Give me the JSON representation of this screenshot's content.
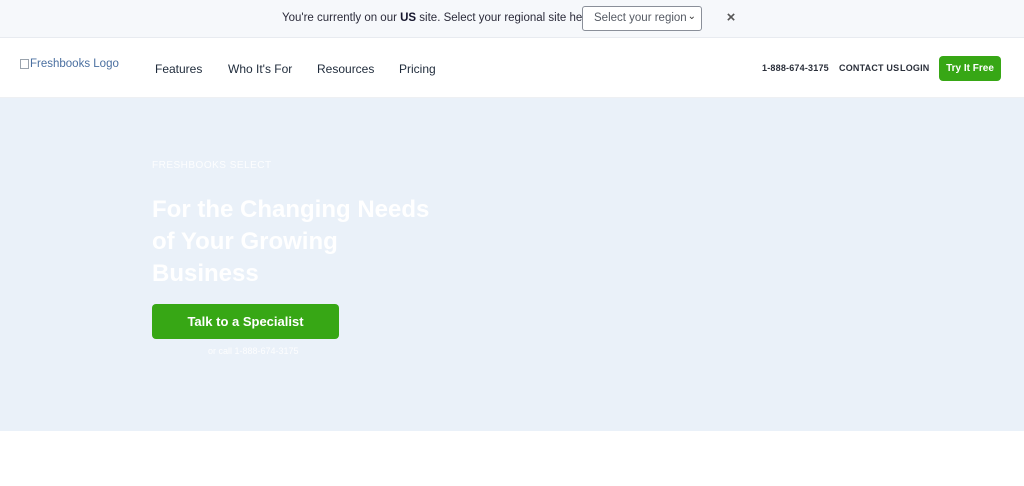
{
  "region_banner": {
    "text_prefix": "You're currently on our ",
    "text_strong": "US",
    "text_suffix": " site. Select your regional site here:",
    "select_value": "Select your region",
    "close_icon": "close-icon"
  },
  "header": {
    "logo_alt": "Freshbooks Logo",
    "nav": [
      "Features",
      "Who It's For",
      "Resources",
      "Pricing"
    ],
    "phone": "1-888-674-3175",
    "contact": "CONTACT US",
    "login": "LOGIN",
    "try_button": "Try It Free"
  },
  "hero": {
    "eyebrow": "FRESHBOOKS SELECT",
    "title": "For the Changing Needs of Your Growing Business",
    "cta": "Talk to a Specialist",
    "cta_sub": "or call 1-888-674-3175"
  },
  "colors": {
    "accent_green": "#37a715",
    "hero_bg": "#eaf1f9",
    "banner_bg": "#f6f8fb"
  }
}
